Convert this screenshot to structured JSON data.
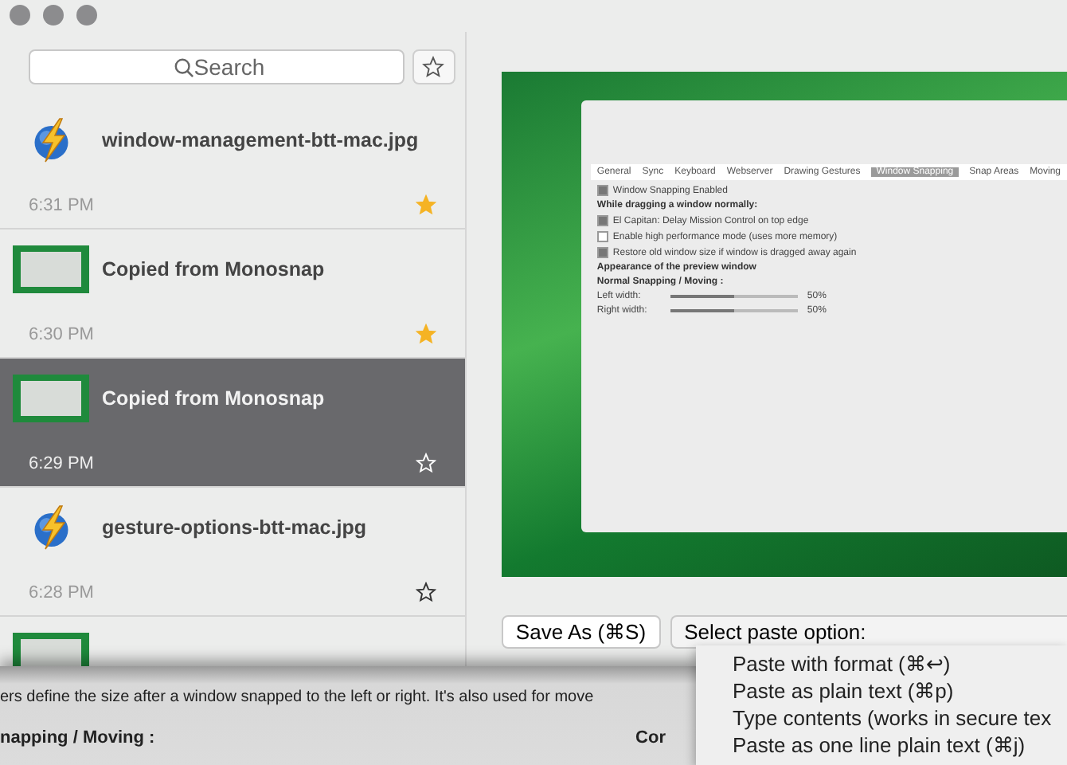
{
  "search": {
    "placeholder": "Search"
  },
  "clips": [
    {
      "kind": "file",
      "title": "window-management-btt-mac.jpg",
      "time": "6:31 PM",
      "starred": true,
      "selected": false
    },
    {
      "kind": "image",
      "title": "Copied from Monosnap",
      "time": "6:30 PM",
      "starred": true,
      "selected": false
    },
    {
      "kind": "image",
      "title": "Copied from Monosnap",
      "time": "6:29 PM",
      "starred": false,
      "selected": true
    },
    {
      "kind": "file",
      "title": "gesture-options-btt-mac.jpg",
      "time": "6:28 PM",
      "starred": false,
      "selected": false
    },
    {
      "kind": "image",
      "selected": false
    }
  ],
  "preview": {
    "tabs": [
      {
        "label": "General",
        "selected": false
      },
      {
        "label": "Sync",
        "selected": false
      },
      {
        "label": "Keyboard",
        "selected": false
      },
      {
        "label": "Webserver",
        "selected": false
      },
      {
        "label": "Drawing Gestures",
        "selected": false
      },
      {
        "label": "Window Snapping",
        "selected": true
      },
      {
        "label": "Snap Areas",
        "selected": false
      },
      {
        "label": "Moving",
        "selected": false
      }
    ],
    "options": [
      {
        "label": "Window Snapping Enabled",
        "checked": true
      },
      {
        "label": "El Capitan: Delay Mission Control on top edge",
        "checked": true
      },
      {
        "label": "Enable high performance mode (uses more memory)",
        "checked": false
      },
      {
        "label": "Restore old window size if window is dragged away again",
        "checked": true
      }
    ],
    "sections": [
      "While dragging a window normally:",
      "Appearance of the preview window",
      "Normal Snapping / Moving :"
    ],
    "sliders": [
      {
        "label": "Left width:",
        "level": 0.5,
        "reading": "50%"
      },
      {
        "label": "Right width:",
        "level": 0.5,
        "reading": "50%"
      }
    ]
  },
  "buttons": {
    "save": "Save As (⌘S)",
    "paste_select": "Select paste option:"
  },
  "paste_menu": [
    "Paste with format (⌘↩)",
    "Paste as plain text (⌘p)",
    "Type contents (works in secure tex",
    "Paste as one line plain text (⌘j)"
  ],
  "overlay": {
    "line": "ers define the size after a window snapped to the left or right. It's also used for move",
    "heading": "napping / Moving :",
    "heading_2": "Cor"
  }
}
